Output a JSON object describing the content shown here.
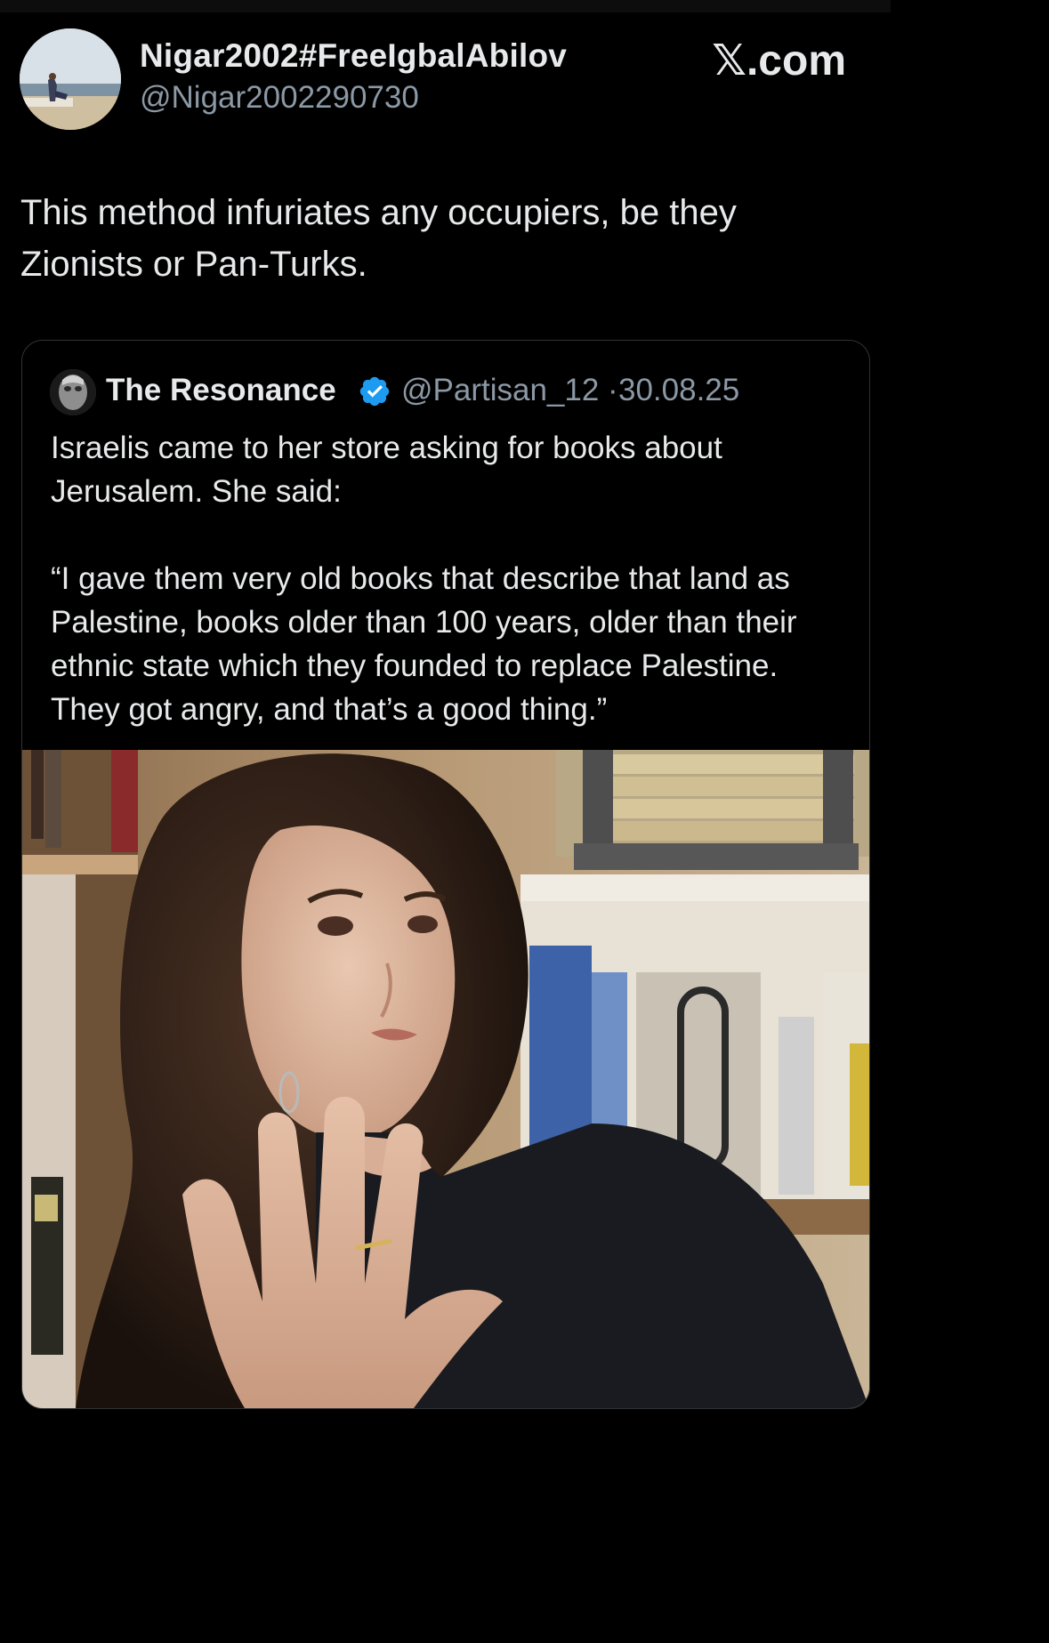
{
  "tweet": {
    "author": {
      "display_name": "Nigar2002#FreeIgbalAbilov",
      "handle": "@Nigar2002290730"
    },
    "site_label": "𝕏.com",
    "text": "This method infuriates any occupiers, be they Zionists or Pan-Turks."
  },
  "quoted_tweet": {
    "author": {
      "display_name": "The Resonance",
      "handle": "@Partisan_12",
      "verified": true
    },
    "separator": "·",
    "date": "30.08.25",
    "paragraphs": [
      "Israelis came to her store asking for books about Jerusalem. She said:",
      "“I gave them very old books that describe that land as Palestine, books older than 100 years, older than their ethnic state which they founded to replace Palestine. They got angry, and that’s a good thing.”"
    ]
  },
  "theme": {
    "background": "#000000",
    "text": "#e7e9ea",
    "secondary_text": "#8b98a5",
    "verified_blue": "#1d9bf0",
    "border": "#2f3336"
  }
}
